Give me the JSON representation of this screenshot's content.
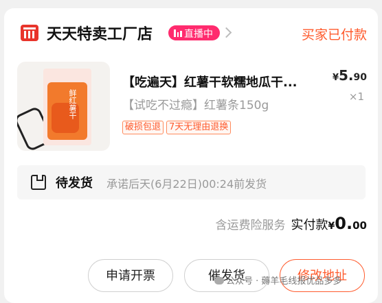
{
  "shop": {
    "name": "天天特卖工厂店",
    "live_badge": "直播中",
    "status": "买家已付款",
    "logo_icon": "shop-logo-icon",
    "accent": "#ff5a2c",
    "live_color": "#ff2b6e"
  },
  "product": {
    "title": "【吃遍天】红薯干软糯地瓜干...",
    "subtitle": "【试吃不过瘾】红薯条150g",
    "tags": [
      "破损包退",
      "7天无理由退换"
    ],
    "price_symbol": "¥",
    "price_int": "5.",
    "price_dec": "90",
    "quantity": "×1",
    "image_text": "鲜红薯干"
  },
  "shipping": {
    "label": "待发货",
    "detail": "承诺后天(6月22日)00:24前发货"
  },
  "payment": {
    "insurance": "含运费险服务",
    "label": "实付款",
    "symbol": "¥",
    "amount_int": "0.",
    "amount_dec": "00"
  },
  "actions": {
    "invoice": "申请开票",
    "urge": "催发货",
    "modify_address": "修改地址"
  },
  "watermark": "公众号 · 薅羊毛线报优品多多"
}
